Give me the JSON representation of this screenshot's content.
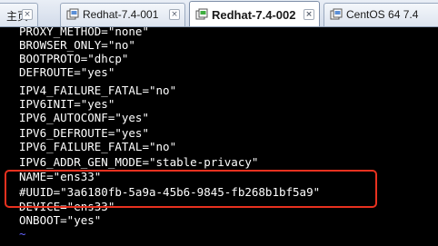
{
  "tabs": [
    {
      "label": "主页",
      "icon": "home-icon",
      "active": false
    },
    {
      "label": "Redhat-7.4-001",
      "icon": "vm-icon",
      "active": false
    },
    {
      "label": "Redhat-7.4-002",
      "icon": "vm-icon",
      "active": true
    },
    {
      "label": "CentOS 64 7.4",
      "icon": "vm-icon",
      "active": false
    }
  ],
  "close_glyph": "×",
  "terminal": {
    "lines": [
      "PROXY_METHOD=\"none\"",
      "BROWSER_ONLY=\"no\"",
      "BOOTPROTO=\"dhcp\"",
      "DEFROUTE=\"yes\"",
      "IPV4_FAILURE_FATAL=\"no\"",
      "IPV6INIT=\"yes\"",
      "IPV6_AUTOCONF=\"yes\"",
      "IPV6_DEFROUTE=\"yes\"",
      "IPV6_FAILURE_FATAL=\"no\"",
      "IPV6_ADDR_GEN_MODE=\"stable-privacy\"",
      "NAME=\"ens33\"",
      "#UUID=\"3a6180fb-5a9a-45b6-9845-fb268b1bf5a9\"",
      "DEVICE=\"ens33\"",
      "ONBOOT=\"yes\""
    ],
    "tildes": [
      "~",
      "~"
    ]
  },
  "colors": {
    "terminal_bg": "#000000",
    "terminal_text": "#ffffff",
    "tilde": "#6464ff",
    "highlight_border": "#e8311f"
  }
}
